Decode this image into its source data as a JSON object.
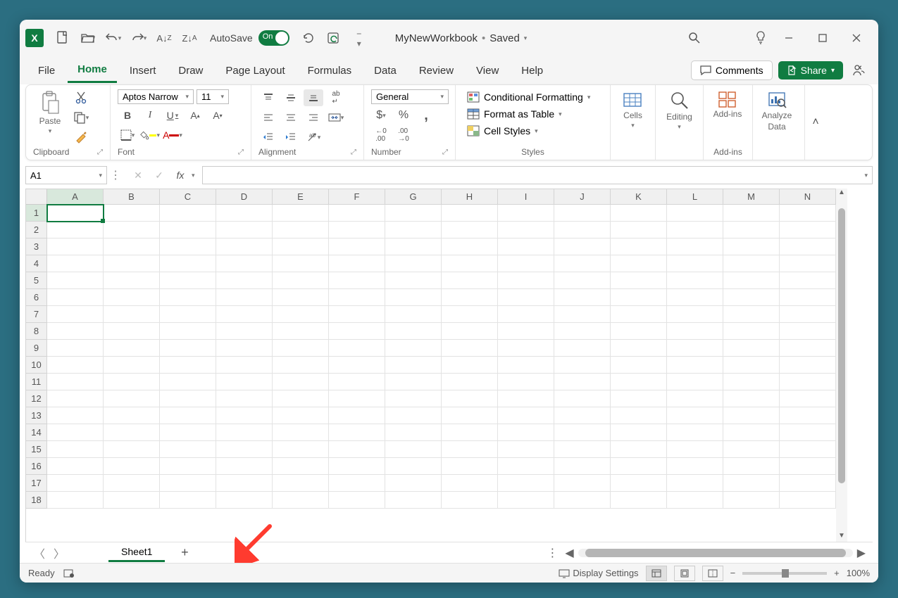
{
  "app": {
    "code": "X"
  },
  "titlebar": {
    "autosave_label": "AutoSave",
    "autosave_state": "On",
    "doc_name": "MyNewWorkbook",
    "doc_status": "Saved"
  },
  "tabs": {
    "items": [
      "File",
      "Home",
      "Insert",
      "Draw",
      "Page Layout",
      "Formulas",
      "Data",
      "Review",
      "View",
      "Help"
    ],
    "active": "Home",
    "comments": "Comments",
    "share": "Share"
  },
  "ribbon": {
    "clipboard": {
      "paste": "Paste",
      "label": "Clipboard"
    },
    "font": {
      "name": "Aptos Narrow",
      "size": "11",
      "label": "Font"
    },
    "alignment": {
      "label": "Alignment"
    },
    "number": {
      "format": "General",
      "label": "Number"
    },
    "styles": {
      "cond": "Conditional Formatting",
      "table": "Format as Table",
      "cell": "Cell Styles",
      "label": "Styles"
    },
    "cells": {
      "label": "Cells"
    },
    "editing": {
      "label": "Editing"
    },
    "addins": {
      "button": "Add-ins",
      "label": "Add-ins"
    },
    "analyze": {
      "line1": "Analyze",
      "line2": "Data"
    }
  },
  "formula_bar": {
    "name_box": "A1",
    "fx": "fx",
    "value": ""
  },
  "grid": {
    "columns": [
      "A",
      "B",
      "C",
      "D",
      "E",
      "F",
      "G",
      "H",
      "I",
      "J",
      "K",
      "L",
      "M",
      "N"
    ],
    "rows": [
      1,
      2,
      3,
      4,
      5,
      6,
      7,
      8,
      9,
      10,
      11,
      12,
      13,
      14,
      15,
      16,
      17,
      18
    ],
    "selected_cell": "A1"
  },
  "sheets": {
    "active": "Sheet1"
  },
  "status": {
    "ready": "Ready",
    "display_settings": "Display Settings",
    "zoom": "100%"
  }
}
